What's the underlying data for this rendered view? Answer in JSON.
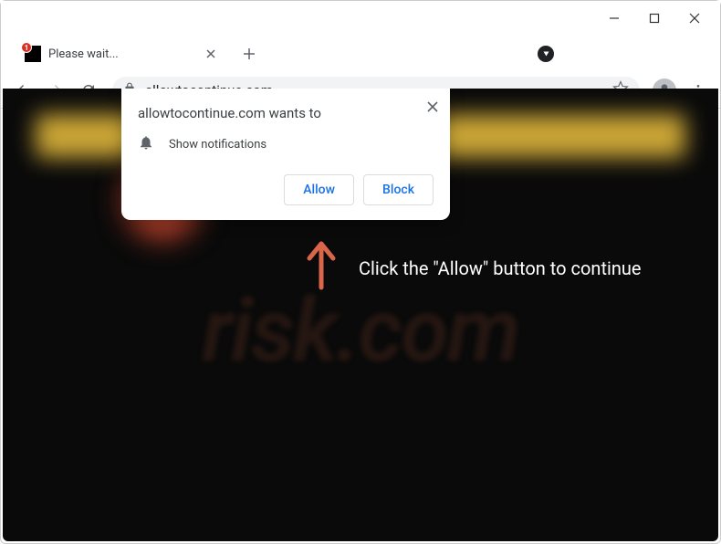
{
  "window": {
    "tab_title": "Please wait...",
    "badge_count": "1"
  },
  "toolbar": {
    "url": "allowtocontinue.com"
  },
  "prompt": {
    "origin_text": "allowtocontinue.com wants to",
    "permission_label": "Show notifications",
    "allow_label": "Allow",
    "block_label": "Block"
  },
  "page": {
    "instruction_text": "Click the \"Allow\" button to continue",
    "watermark_text": "risk.com"
  }
}
